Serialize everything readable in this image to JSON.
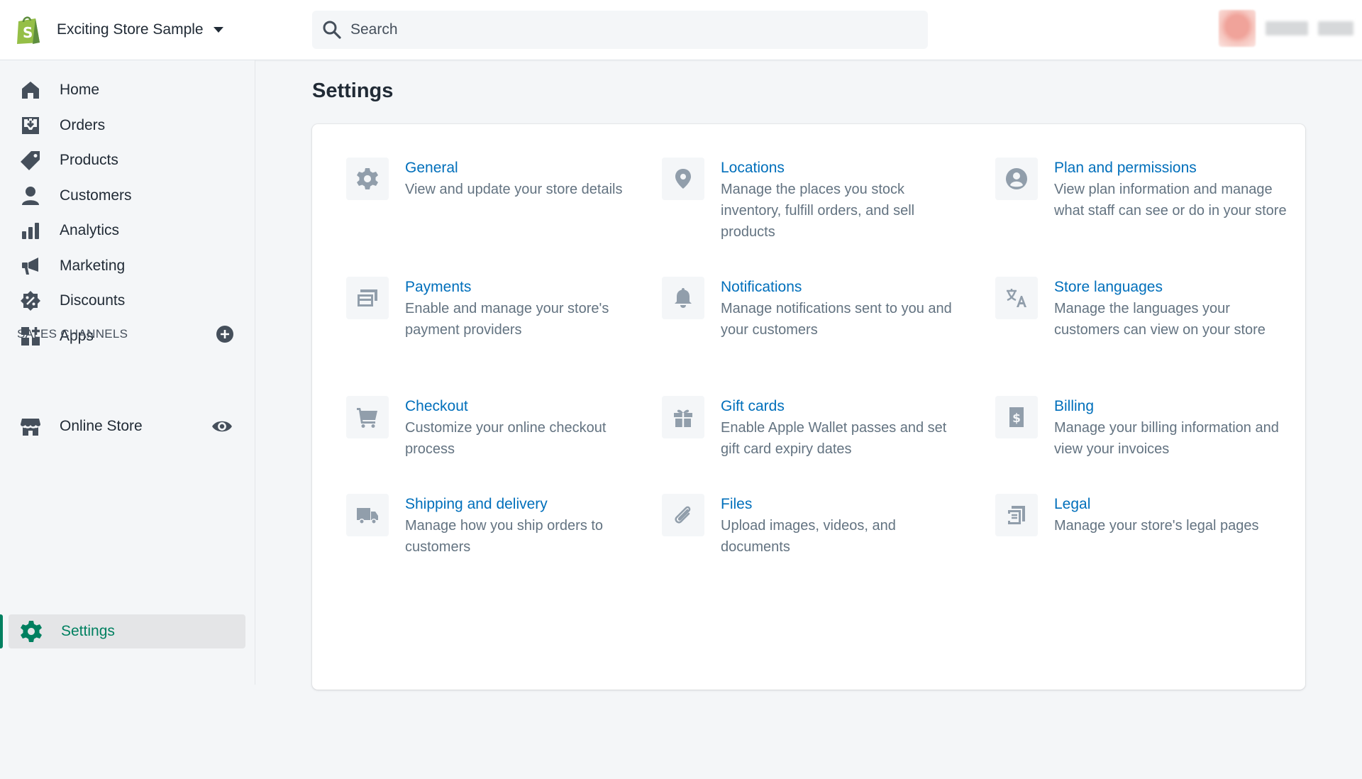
{
  "topbar": {
    "store_name": "Exciting Store Sample",
    "search_placeholder": "Search"
  },
  "sidebar": {
    "items": [
      {
        "label": "Home",
        "icon": "home-icon"
      },
      {
        "label": "Orders",
        "icon": "orders-icon"
      },
      {
        "label": "Products",
        "icon": "tag-icon"
      },
      {
        "label": "Customers",
        "icon": "person-icon"
      },
      {
        "label": "Analytics",
        "icon": "bar-chart-icon"
      },
      {
        "label": "Marketing",
        "icon": "megaphone-icon"
      },
      {
        "label": "Discounts",
        "icon": "discount-icon"
      },
      {
        "label": "Apps",
        "icon": "apps-icon"
      }
    ],
    "sales_channels_title": "SALES CHANNELS",
    "online_store_label": "Online Store",
    "settings_label": "Settings"
  },
  "main": {
    "title": "Settings",
    "tiles": [
      {
        "title": "General",
        "desc": "View and update your store details",
        "icon": "gear-icon"
      },
      {
        "title": "Locations",
        "desc": "Manage the places you stock inventory, fulfill orders, and sell products",
        "icon": "location-pin-icon"
      },
      {
        "title": "Plan and permissions",
        "desc": "View plan information and manage what staff can see or do in your store",
        "icon": "user-circle-icon"
      },
      {
        "title": "Payments",
        "desc": "Enable and manage your store's payment providers",
        "icon": "payments-icon"
      },
      {
        "title": "Notifications",
        "desc": "Manage notifications sent to you and your customers",
        "icon": "bell-icon"
      },
      {
        "title": "Store languages",
        "desc": "Manage the languages your customers can view on your store",
        "icon": "translate-icon"
      },
      {
        "title": "Checkout",
        "desc": "Customize your online checkout process",
        "icon": "cart-icon"
      },
      {
        "title": "Gift cards",
        "desc": "Enable Apple Wallet passes and set gift card expiry dates",
        "icon": "gift-icon"
      },
      {
        "title": "Billing",
        "desc": "Manage your billing information and view your invoices",
        "icon": "billing-icon"
      },
      {
        "title": "Shipping and delivery",
        "desc": "Manage how you ship orders to customers",
        "icon": "truck-icon"
      },
      {
        "title": "Files",
        "desc": "Upload images, videos, and documents",
        "icon": "paperclip-icon"
      },
      {
        "title": "Legal",
        "desc": "Manage your store's legal pages",
        "icon": "legal-icon"
      }
    ]
  },
  "colors": {
    "accent_green": "#008060",
    "link_blue": "#006fbb",
    "muted_text": "#637381",
    "icon_gray": "#919eab"
  }
}
